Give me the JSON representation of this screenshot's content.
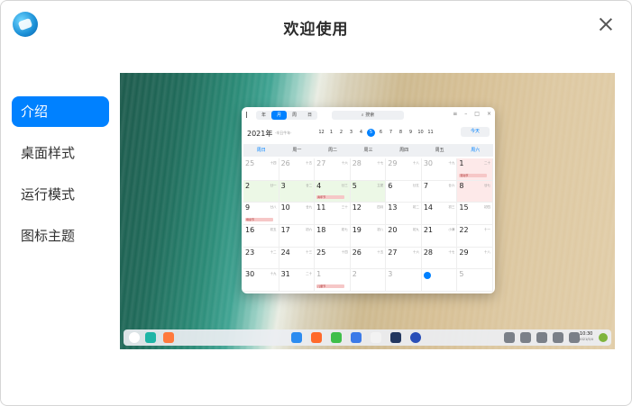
{
  "window": {
    "title": "欢迎使用"
  },
  "sidebar": {
    "items": [
      {
        "label": "介绍",
        "active": true
      },
      {
        "label": "桌面样式",
        "active": false
      },
      {
        "label": "运行模式",
        "active": false
      },
      {
        "label": "图标主题",
        "active": false
      }
    ]
  },
  "calendar": {
    "views": [
      "年",
      "月",
      "周",
      "日"
    ],
    "active_view": "月",
    "search_placeholder": "搜索",
    "year_label": "2021年",
    "year_sub": "·辛丑牛年·",
    "months": [
      "12",
      "1",
      "2",
      "3",
      "4",
      "5",
      "6",
      "7",
      "8",
      "9",
      "10",
      "11"
    ],
    "current_month": "5",
    "today_label": "今天",
    "weekdays": [
      "周日",
      "周一",
      "周二",
      "周三",
      "周四",
      "周五",
      "周六"
    ],
    "days": [
      {
        "d": "25",
        "l": "十四",
        "dim": true
      },
      {
        "d": "26",
        "l": "十五",
        "dim": true
      },
      {
        "d": "27",
        "l": "十六",
        "dim": true
      },
      {
        "d": "28",
        "l": "十七",
        "dim": true
      },
      {
        "d": "29",
        "l": "十八",
        "dim": true
      },
      {
        "d": "30",
        "l": "十九",
        "dim": true
      },
      {
        "d": "1",
        "l": "二十",
        "bg": "red",
        "ev": "劳动节"
      },
      {
        "d": "2",
        "l": "廿一",
        "bg": "green"
      },
      {
        "d": "3",
        "l": "廿二",
        "bg": "green"
      },
      {
        "d": "4",
        "l": "廿三",
        "bg": "green",
        "ev": "青年节"
      },
      {
        "d": "5",
        "l": "立夏",
        "bg": "green"
      },
      {
        "d": "6",
        "l": "廿五"
      },
      {
        "d": "7",
        "l": "廿六"
      },
      {
        "d": "8",
        "l": "廿七",
        "bg": "red"
      },
      {
        "d": "9",
        "l": "廿八",
        "ev": "母亲节"
      },
      {
        "d": "10",
        "l": "廿九"
      },
      {
        "d": "11",
        "l": "三十"
      },
      {
        "d": "12",
        "l": "四月"
      },
      {
        "d": "13",
        "l": "初二"
      },
      {
        "d": "14",
        "l": "初三"
      },
      {
        "d": "15",
        "l": "初四"
      },
      {
        "d": "16",
        "l": "初五"
      },
      {
        "d": "17",
        "l": "初六"
      },
      {
        "d": "18",
        "l": "初七"
      },
      {
        "d": "19",
        "l": "初八"
      },
      {
        "d": "20",
        "l": "初九"
      },
      {
        "d": "21",
        "l": "小满"
      },
      {
        "d": "22",
        "l": "十一"
      },
      {
        "d": "23",
        "l": "十二"
      },
      {
        "d": "24",
        "l": "十三"
      },
      {
        "d": "25",
        "l": "十四"
      },
      {
        "d": "26",
        "l": "十五"
      },
      {
        "d": "27",
        "l": "十六"
      },
      {
        "d": "28",
        "l": "十七"
      },
      {
        "d": "29",
        "l": "十八"
      },
      {
        "d": "30",
        "l": "十九"
      },
      {
        "d": "31",
        "l": "二十"
      },
      {
        "d": "1",
        "l": "",
        "dim": true,
        "ev": "儿童节"
      },
      {
        "d": "2",
        "l": "",
        "dim": true
      },
      {
        "d": "3",
        "l": "",
        "dim": true
      },
      {
        "d": "4",
        "l": "",
        "dim": true,
        "today": true
      },
      {
        "d": "5",
        "l": "",
        "dim": true
      }
    ]
  },
  "dock": {
    "time": "10:30",
    "date": "2021/5/4"
  },
  "colors": {
    "accent": "#0081ff"
  }
}
